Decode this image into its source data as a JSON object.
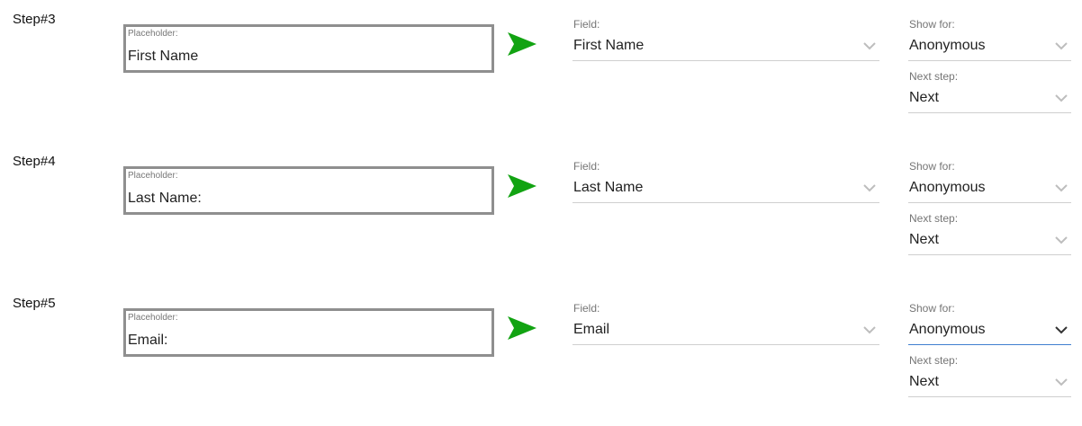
{
  "steps": [
    {
      "label": "Step#3",
      "placeholder_caption": "Placeholder:",
      "placeholder_value": "First Name",
      "field_caption": "Field:",
      "field_value": "First Name",
      "show_for_caption": "Show for:",
      "show_for_value": "Anonymous",
      "next_step_caption": "Next step:",
      "next_step_value": "Next"
    },
    {
      "label": "Step#4",
      "placeholder_caption": "Placeholder:",
      "placeholder_value": "Last Name:",
      "field_caption": "Field:",
      "field_value": "Last Name",
      "show_for_caption": "Show for:",
      "show_for_value": "Anonymous",
      "next_step_caption": "Next step:",
      "next_step_value": "Next"
    },
    {
      "label": "Step#5",
      "placeholder_caption": "Placeholder:",
      "placeholder_value": "Email:",
      "field_caption": "Field:",
      "field_value": "Email",
      "show_for_caption": "Show for:",
      "show_for_value": "Anonymous",
      "next_step_caption": "Next step:",
      "next_step_value": "Next"
    }
  ],
  "colors": {
    "arrow": "#12a312",
    "box_border": "#8f8f8f",
    "focus_underline": "#3f7fd0",
    "chevron": "#bdbdbd",
    "chevron_focused": "#333333"
  },
  "icons": {
    "arrow": "send-arrow-icon",
    "chevron": "chevron-down-icon"
  }
}
